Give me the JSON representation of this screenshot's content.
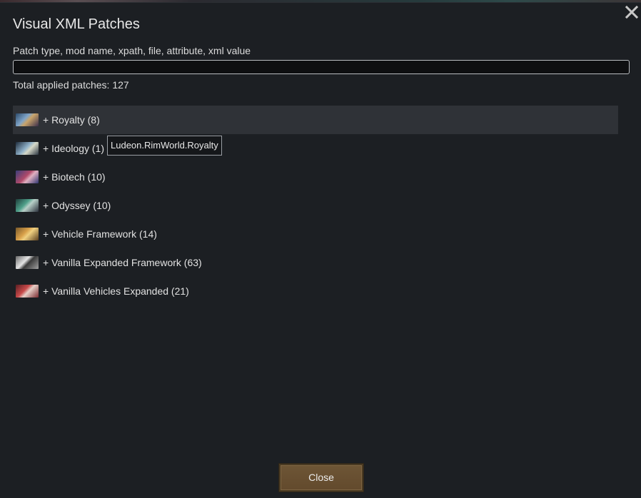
{
  "window": {
    "title": "Visual XML Patches"
  },
  "search": {
    "label": "Patch type, mod name, xpath, file, attribute, xml value",
    "value": "",
    "placeholder": ""
  },
  "summary": {
    "total_text": "Total applied patches: 127"
  },
  "mods": [
    {
      "label": "+ Royalty (8)",
      "thumb": "royalty-thumbnail"
    },
    {
      "label": "+ Ideology (1)",
      "thumb": "ideology-thumbnail"
    },
    {
      "label": "+ Biotech (10)",
      "thumb": "biotech-thumbnail"
    },
    {
      "label": "+ Odyssey (10)",
      "thumb": "odyssey-thumbnail"
    },
    {
      "label": "+ Vehicle Framework (14)",
      "thumb": "vehicle-framework-thumbnail"
    },
    {
      "label": "+ Vanilla Expanded Framework (63)",
      "thumb": "vanilla-expanded-framework-thumbnail"
    },
    {
      "label": "+ Vanilla Vehicles Expanded (21)",
      "thumb": "vanilla-vehicles-expanded-thumbnail"
    }
  ],
  "tooltip": {
    "text": "Ludeon.RimWorld.Royalty"
  },
  "footer": {
    "close_label": "Close"
  },
  "icons": {
    "close": "close-icon"
  },
  "colors": {
    "background": "#1c1f23",
    "row_hover": "#2f3237",
    "button": "#6a5232"
  }
}
